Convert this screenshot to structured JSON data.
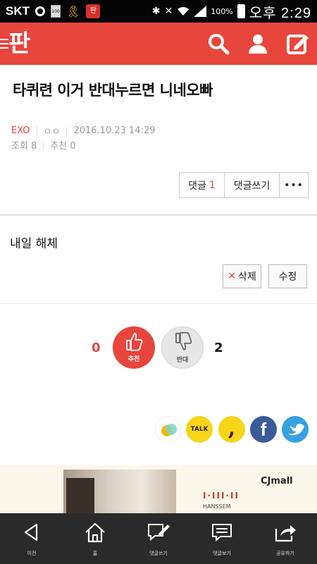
{
  "status_bar": {
    "carrier": "SKT",
    "battery_small_label": "100",
    "app_icon_label": "판",
    "battery_percent": "100%",
    "time": "오후 2:29"
  },
  "header": {
    "logo": "판",
    "icons": [
      "menu-icon",
      "search-icon",
      "user-icon",
      "compose-icon"
    ],
    "background_color": "#e8453c"
  },
  "post": {
    "title": "타퀴련 이거 반대누르면 니네오빠",
    "category": "EXO",
    "author": "ㅇㅇ",
    "date": "2016.10.23 14:29",
    "views": "조회 8",
    "recommends": "추천 0",
    "body": "내일 해체"
  },
  "actions": {
    "comment_label": "댓글",
    "comment_count": "1",
    "write_comment_label": "댓글쓰기",
    "more_label": "•••",
    "delete_label": "삭제",
    "edit_label": "수정"
  },
  "votes": {
    "up_count": "0",
    "up_label": "추천",
    "down_label": "반대",
    "down_count": "2"
  },
  "share": {
    "icons": [
      "kakaostory-icon",
      "kakaotalk-icon",
      "kakao-quote-icon",
      "facebook-icon",
      "twitter-icon"
    ],
    "talk_label": "TALK",
    "quote_label": ",",
    "facebook_label": "f"
  },
  "ad": {
    "cj_label": "CJmall",
    "brand_label": "HANSSEM"
  },
  "bottom_nav": {
    "items": [
      {
        "icon": "back-icon",
        "label": "이전"
      },
      {
        "icon": "home-icon",
        "label": "홈"
      },
      {
        "icon": "write-comment-icon",
        "label": "댓글쓰기"
      },
      {
        "icon": "view-comments-icon",
        "label": "댓글보기"
      },
      {
        "icon": "share-icon",
        "label": "공유하기"
      }
    ]
  }
}
